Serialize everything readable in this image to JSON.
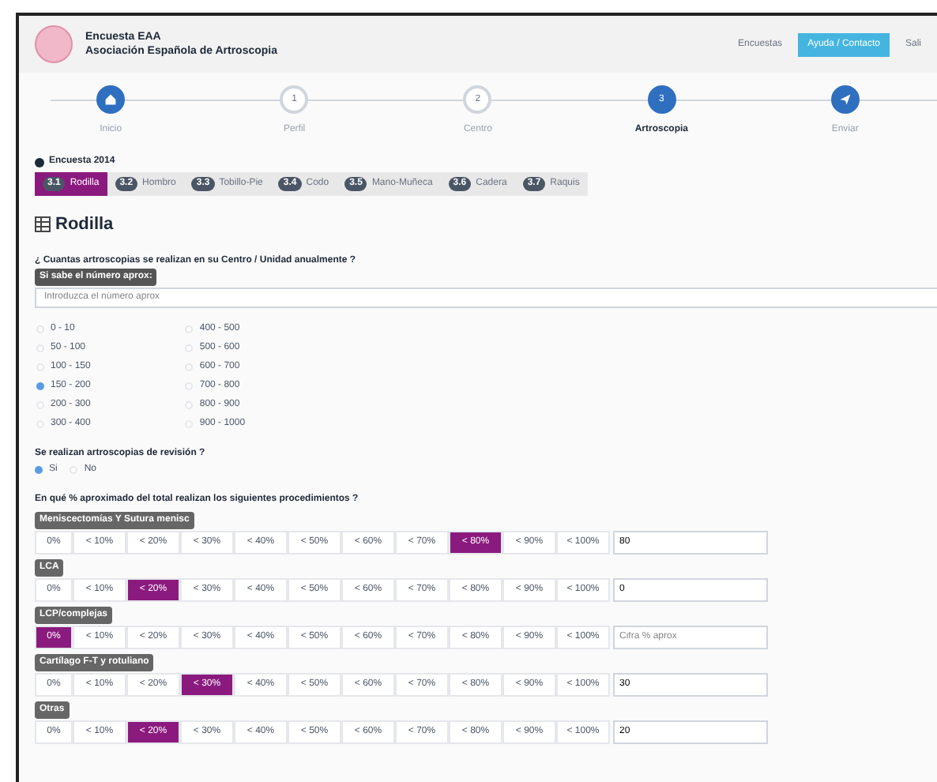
{
  "header": {
    "title": "Encuesta EAA",
    "subtitle": "Asociación Española de Artroscopia",
    "nav": [
      {
        "label": "Encuestas",
        "selected": false
      },
      {
        "label": "Ayuda / Contacto",
        "selected": true
      },
      {
        "label": "Sali",
        "selected": false
      }
    ]
  },
  "steps": [
    {
      "kind": "home",
      "label": "Inicio",
      "selected": false,
      "done": true
    },
    {
      "kind": "number",
      "number": "1",
      "label": "Perfil",
      "selected": false,
      "done": false
    },
    {
      "kind": "number",
      "number": "2",
      "label": "Centro",
      "selected": false,
      "done": false
    },
    {
      "kind": "number",
      "number": "3",
      "label": "Artroscopia",
      "selected": true,
      "done": true
    },
    {
      "kind": "send",
      "label": "Enviar",
      "selected": false,
      "done": true
    }
  ],
  "survey_label": "Encuesta 2014",
  "tabs": [
    {
      "number": "3.1",
      "label": "Rodilla",
      "selected": true
    },
    {
      "number": "3.2",
      "label": "Hombro",
      "selected": false
    },
    {
      "number": "3.3",
      "label": "Tobillo-Pie",
      "selected": false
    },
    {
      "number": "3.4",
      "label": "Codo",
      "selected": false
    },
    {
      "number": "3.5",
      "label": "Mano-Muñeca",
      "selected": false
    },
    {
      "number": "3.6",
      "label": "Cadera",
      "selected": false
    },
    {
      "number": "3.7",
      "label": "Raquis",
      "selected": false
    }
  ],
  "section_title": "Rodilla",
  "question_1": {
    "text": "¿ Cuantas artroscopias se realizan en su Centro / Unidad anualmente ?",
    "field_label": "Si sabe el número aprox:",
    "placeholder": "Introduzca el número aprox",
    "options": [
      {
        "label": "0 - 10",
        "selected": false
      },
      {
        "label": "50 - 100",
        "selected": false
      },
      {
        "label": "100 - 150",
        "selected": false
      },
      {
        "label": "150 - 200",
        "selected": true
      },
      {
        "label": "200 - 300",
        "selected": false
      },
      {
        "label": "300 - 400",
        "selected": false
      },
      {
        "label": "400 - 500",
        "selected": false
      },
      {
        "label": "500 - 600",
        "selected": false
      },
      {
        "label": "600 - 700",
        "selected": false
      },
      {
        "label": "700 - 800",
        "selected": false
      },
      {
        "label": "800 - 900",
        "selected": false
      },
      {
        "label": "900 - 1000",
        "selected": false
      }
    ]
  },
  "question_2": {
    "text": "Se realizan artroscopias de revisión ?",
    "options": [
      {
        "label": "Si",
        "selected": true
      },
      {
        "label": "No",
        "selected": false
      }
    ]
  },
  "question_3": {
    "text": "En qué % aproximado del total realizan los siguientes procedimientos ?",
    "groups": [
      {
        "label": "Meniscectomías Y Sutura menisc",
        "value": "80",
        "options": [
          {
            "label": "0%",
            "selected": false
          },
          {
            "label": "< 10%",
            "selected": false
          },
          {
            "label": "< 20%",
            "selected": false
          },
          {
            "label": "< 30%",
            "selected": false
          },
          {
            "label": "< 40%",
            "selected": false
          },
          {
            "label": "< 50%",
            "selected": false
          },
          {
            "label": "< 60%",
            "selected": false
          },
          {
            "label": "< 70%",
            "selected": false
          },
          {
            "label": "< 80%",
            "selected": true
          },
          {
            "label": "< 90%",
            "selected": false
          },
          {
            "label": "< 100%",
            "selected": false
          }
        ]
      },
      {
        "label": "LCA",
        "value": "0",
        "options": [
          {
            "label": "0%",
            "selected": false
          },
          {
            "label": "< 10%",
            "selected": false
          },
          {
            "label": "< 20%",
            "selected": true
          },
          {
            "label": "< 30%",
            "selected": false
          },
          {
            "label": "< 40%",
            "selected": false
          },
          {
            "label": "< 50%",
            "selected": false
          },
          {
            "label": "< 60%",
            "selected": false
          },
          {
            "label": "< 70%",
            "selected": false
          },
          {
            "label": "< 80%",
            "selected": false
          },
          {
            "label": "< 90%",
            "selected": false
          },
          {
            "label": "< 100%",
            "selected": false
          }
        ]
      },
      {
        "label": "LCP/complejas",
        "placeholder": "Cifra % aprox",
        "options": [
          {
            "label": "0%",
            "selected": true
          },
          {
            "label": "< 10%",
            "selected": false
          },
          {
            "label": "< 20%",
            "selected": false
          },
          {
            "label": "< 30%",
            "selected": false
          },
          {
            "label": "< 40%",
            "selected": false
          },
          {
            "label": "< 50%",
            "selected": false
          },
          {
            "label": "< 60%",
            "selected": false
          },
          {
            "label": "< 70%",
            "selected": false
          },
          {
            "label": "< 80%",
            "selected": false
          },
          {
            "label": "< 90%",
            "selected": false
          },
          {
            "label": "< 100%",
            "selected": false
          }
        ]
      },
      {
        "label": "Cartílago F-T y rotuliano",
        "value": "30",
        "options": [
          {
            "label": "0%",
            "selected": false
          },
          {
            "label": "< 10%",
            "selected": false
          },
          {
            "label": "< 20%",
            "selected": false
          },
          {
            "label": "< 30%",
            "selected": true
          },
          {
            "label": "< 40%",
            "selected": false
          },
          {
            "label": "< 50%",
            "selected": false
          },
          {
            "label": "< 60%",
            "selected": false
          },
          {
            "label": "< 70%",
            "selected": false
          },
          {
            "label": "< 80%",
            "selected": false
          },
          {
            "label": "< 90%",
            "selected": false
          },
          {
            "label": "< 100%",
            "selected": false
          }
        ]
      },
      {
        "label": "Otras",
        "value": "20",
        "options": [
          {
            "label": "0%",
            "selected": false
          },
          {
            "label": "< 10%",
            "selected": false
          },
          {
            "label": "< 20%",
            "selected": true
          },
          {
            "label": "< 30%",
            "selected": false
          },
          {
            "label": "< 40%",
            "selected": false
          },
          {
            "label": "< 50%",
            "selected": false
          },
          {
            "label": "< 60%",
            "selected": false
          },
          {
            "label": "< 70%",
            "selected": false
          },
          {
            "label": "< 80%",
            "selected": false
          },
          {
            "label": "< 90%",
            "selected": false
          },
          {
            "label": "< 100%",
            "selected": false
          }
        ]
      }
    ]
  }
}
